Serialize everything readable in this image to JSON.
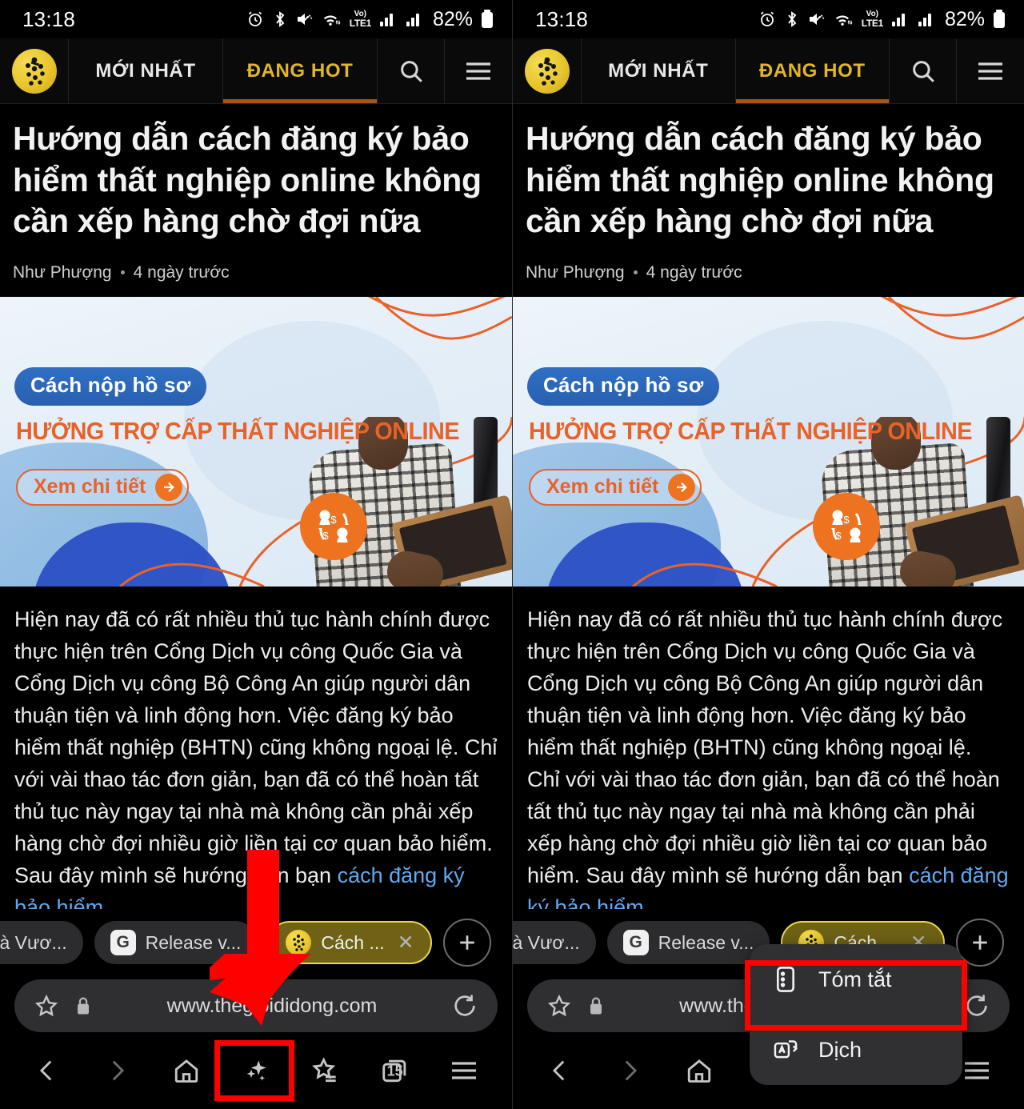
{
  "status_bar": {
    "time": "13:18",
    "battery_percent": "82%",
    "network_label_top": "Vo)",
    "network_label_bottom": "LTE1",
    "icons": [
      "alarm-icon",
      "bluetooth-icon",
      "mute-icon",
      "wifi-icon",
      "volte-icon",
      "signal-icon-1",
      "signal-icon-2",
      "battery-icon"
    ]
  },
  "site_header": {
    "logo_name": "thegioididong-logo",
    "tabs": [
      {
        "label": "MỚI NHẤT",
        "active": false
      },
      {
        "label": "ĐANG HOT",
        "active": true
      }
    ],
    "search_icon": "search-icon",
    "menu_icon": "hamburger-menu-icon",
    "active_color": "#e3b625",
    "underline_color": "#a8541a"
  },
  "article": {
    "headline": "Hướng dẫn cách đăng ký bảo hiểm thất nghiệp online không cần xếp hàng chờ đợi nữa",
    "author": "Như Phượng",
    "time_ago": "4 ngày trước"
  },
  "banner": {
    "badge": "Cách nộp hồ sơ",
    "title": "HƯỞNG TRỢ CẤP THẤT NGHIỆP ONLINE",
    "cta": "Xem chi tiết",
    "badge_color": "#2f6fc4",
    "title_color": "#e8622a",
    "cta_color": "#ee7321"
  },
  "body": {
    "paragraph": "Hiện nay đã có rất nhiều thủ tục hành chính được thực hiện trên Cổng Dịch vụ công Quốc Gia và Cổng Dịch vụ công Bộ Công An giúp người dân thuận tiện và linh động hơn. Việc đăng ký bảo hiểm thất nghiệp (BHTN) cũng không ngoại lệ. Chỉ với vài thao tác đơn giản, bạn đã có thể hoàn tất thủ tục này ngay tại nhà mà không cần phải xếp hàng chờ đợi nhiều giờ liền tại cơ quan bảo hiểm. Sau đây mình sẽ hướng dẫn bạn ",
    "link_text": "cách đăng ký bảo hiểm",
    "link_color": "#61a9f0"
  },
  "browser": {
    "tabs": [
      {
        "title": "Ta Là Vươ...",
        "icon": "none",
        "active": false
      },
      {
        "title": "Release v...",
        "icon": "google-icon",
        "icon_letter": "G",
        "active": false
      },
      {
        "title": "Cách ...",
        "icon": "site-favicon",
        "active": true,
        "close_label": "✕"
      }
    ],
    "new_tab_label": "+",
    "url": "www.thegioididong.com",
    "url_bookmark_icon": "star-icon",
    "url_lock_icon": "lock-icon",
    "url_reload_icon": "reload-icon",
    "toolbar": [
      {
        "name": "back-button",
        "icon": "chevron-left-icon"
      },
      {
        "name": "forward-button",
        "icon": "chevron-right-icon"
      },
      {
        "name": "home-button",
        "icon": "home-icon"
      },
      {
        "name": "ai-assist-button",
        "icon": "sparkle-icon"
      },
      {
        "name": "bookmarks-button",
        "icon": "star-list-icon"
      },
      {
        "name": "tabs-button",
        "icon": "tabs-icon",
        "count": "15"
      },
      {
        "name": "menu-button",
        "icon": "hamburger-menu-icon"
      }
    ]
  },
  "popup_menu": {
    "items": [
      {
        "label": "Tóm tắt",
        "icon": "summarize-icon",
        "highlighted": true
      },
      {
        "label": "Dịch",
        "icon": "translate-icon",
        "highlighted": false
      }
    ]
  },
  "annotations": {
    "highlight_color": "#ff0000",
    "arrow_name": "red-down-arrow",
    "box_sparkle_name": "highlight-box-sparkle",
    "box_summary_name": "highlight-box-tom-tat"
  }
}
